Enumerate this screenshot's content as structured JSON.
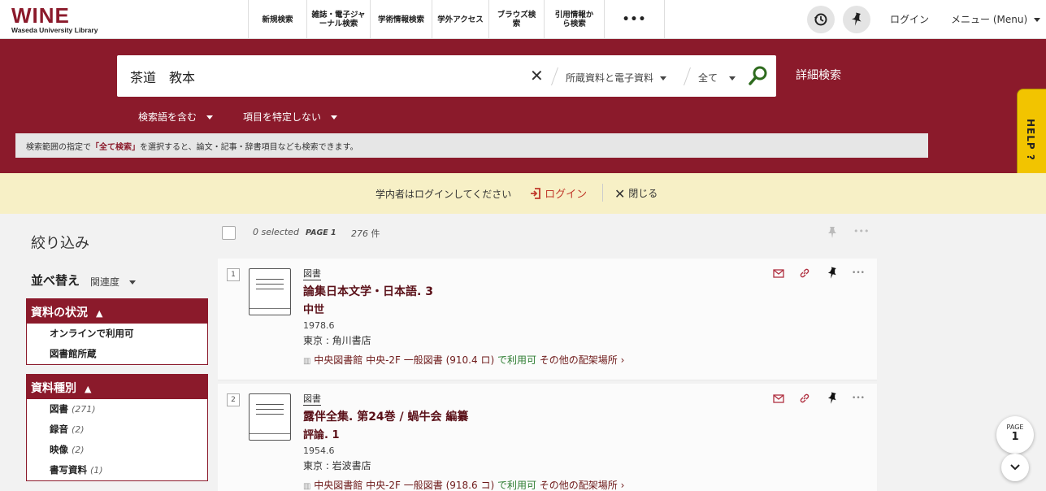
{
  "header": {
    "logo_main": "WINE",
    "logo_sub": "Waseda University Library",
    "nav": [
      {
        "label": "新規検索"
      },
      {
        "label": "雑誌・電子ジャーナル検索"
      },
      {
        "label": "学術情報検索"
      },
      {
        "label": "学外アクセス"
      },
      {
        "label": "ブラウズ検索"
      },
      {
        "label": "引用情報から検索"
      },
      {
        "label": "•••"
      }
    ],
    "login": "ログイン",
    "menu": "メニュー (Menu)"
  },
  "search": {
    "query": "茶道　教本",
    "scope": "所蔵資料と電子資料",
    "range": "全て",
    "advanced": "詳細検索",
    "option_match": "検索語を含む",
    "option_field": "項目を特定しない",
    "hint_pre": "検索範囲の指定で",
    "hint_bold": "「全て検索」",
    "hint_post": "を選択すると、論文・記事・辞書項目なども検索できます。",
    "help": "HELP ?"
  },
  "notice": {
    "message": "学内者はログインしてください",
    "login": "ログイン",
    "close": "閉じる"
  },
  "sidebar": {
    "title": "絞り込み",
    "sort_label": "並べ替え",
    "sort_value": "関連度",
    "facets": [
      {
        "title": "資料の状況",
        "items": [
          {
            "label": "オンラインで利用可",
            "count": ""
          },
          {
            "label": "図書館所蔵",
            "count": ""
          }
        ]
      },
      {
        "title": "資料種別",
        "items": [
          {
            "label": "図書",
            "count": "(271)"
          },
          {
            "label": "録音",
            "count": "(2)"
          },
          {
            "label": "映像",
            "count": "(2)"
          },
          {
            "label": "書写資料",
            "count": "(1)"
          }
        ]
      }
    ]
  },
  "results_header": {
    "selected": "0 selected",
    "page": "PAGE 1",
    "count": "276",
    "count_unit": "件"
  },
  "results": [
    {
      "num": "1",
      "type": "図書",
      "title": "論集日本文学・日本語. 3",
      "subtitle": "中世",
      "date": "1978.6",
      "publisher": "東京 : 角川書店",
      "holding": "中央図書館  中央-2F 一般図書 (910.4 ロ)",
      "availability": "で利用可",
      "other": "その他の配架場所 ›"
    },
    {
      "num": "2",
      "type": "図書",
      "title": "露伴全集. 第24巻 / 蝸牛会 編纂",
      "subtitle": "評論. 1",
      "date": "1954.6",
      "publisher": "東京 : 岩波書店",
      "holding": "中央図書館  中央-2F 一般図書 (918.6 コ)",
      "availability": "で利用可",
      "other": "その他の配架場所 ›"
    }
  ],
  "pager": {
    "label": "PAGE",
    "number": "1"
  },
  "colors": {
    "brand": "#8b1a2b",
    "help": "#f2c400",
    "notice": "#f7f0c6"
  }
}
